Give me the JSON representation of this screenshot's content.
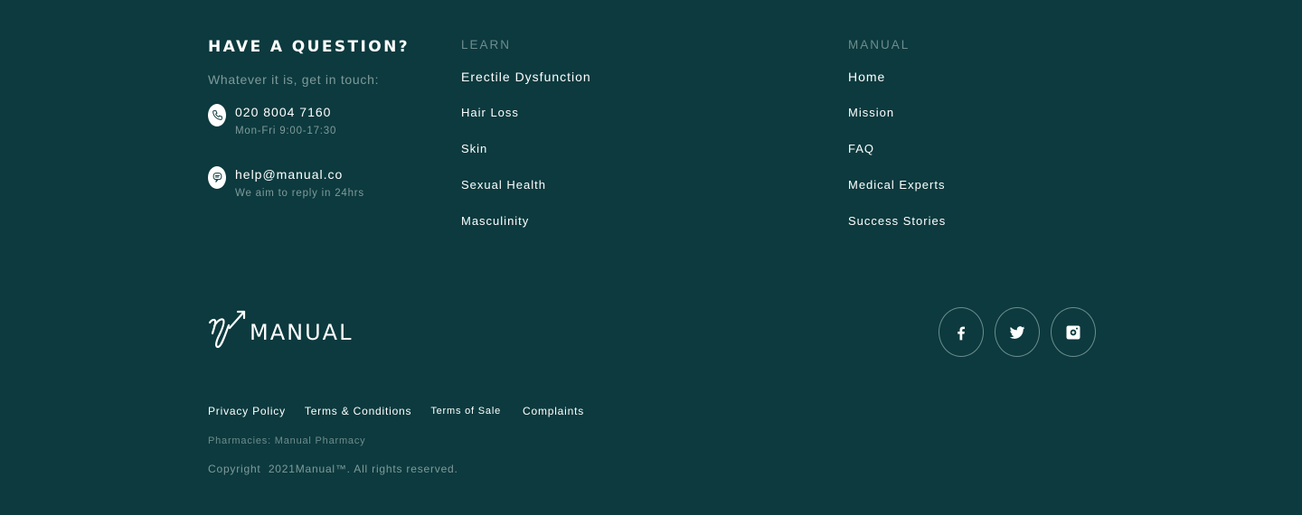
{
  "contact": {
    "title": "HAVE A QUESTION?",
    "subtitle": "Whatever it is, get in touch:",
    "phone": {
      "icon": "phone-icon",
      "value": "020 8004 7160",
      "note": "Mon-Fri 9:00-17:30"
    },
    "email": {
      "icon": "chat-icon",
      "value": "help@manual.co",
      "note": "We aim to reply in 24hrs"
    }
  },
  "learn": {
    "title": "LEARN",
    "links": [
      "Erectile Dysfunction",
      "Hair Loss",
      "Skin",
      "Sexual Health",
      "Masculinity"
    ]
  },
  "manual": {
    "title": "MANUAL",
    "links": [
      "Home",
      "Mission",
      "FAQ",
      "Medical Experts",
      "Success Stories"
    ]
  },
  "logo": {
    "text": "MANUAL",
    "icon": "manual-logo-mark"
  },
  "social": [
    {
      "name": "facebook",
      "icon": "facebook-icon"
    },
    {
      "name": "twitter",
      "icon": "twitter-icon"
    },
    {
      "name": "instagram",
      "icon": "instagram-icon"
    }
  ],
  "legal": {
    "links": [
      "Privacy Policy",
      "Terms & Conditions",
      "Terms of Sale",
      "Complaints"
    ],
    "pharmacies": "Pharmacies: Manual Pharmacy",
    "copyright": "Copyright  2021Manual™. All rights reserved."
  },
  "colors": {
    "background": "#0c3a3e",
    "text": "#ffffff",
    "muted": "#7f9a9b"
  }
}
